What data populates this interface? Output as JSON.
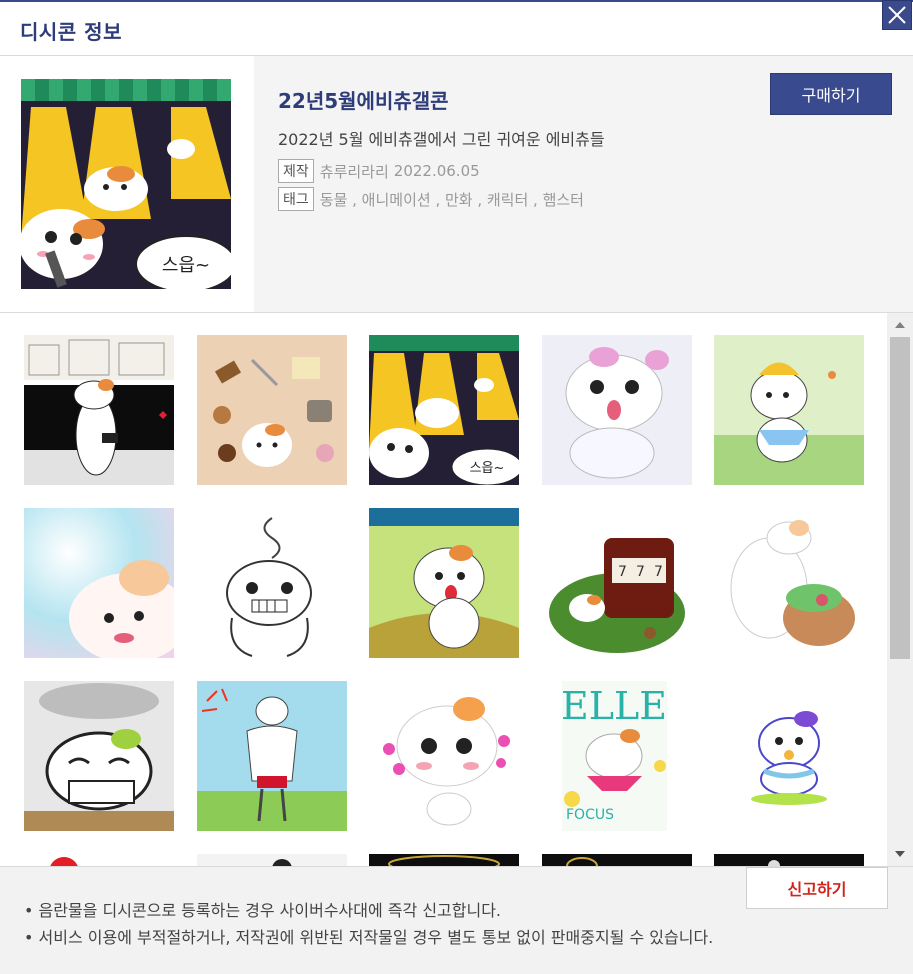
{
  "header": {
    "title": "디시콘 정보"
  },
  "dcon": {
    "title": "22년5월에비츄갤콘",
    "description": "2022년 5월 에비츄갤에서 그린 귀여운 에비츄들",
    "maker_label": "제작",
    "maker": "츄루리라리",
    "date": "2022.06.05",
    "tag_label": "태그",
    "tags": "동물 , 애니메이션 , 만화 , 캐릭터 , 햄스터",
    "buy_label": "구매하기",
    "thumb_caption": "스읍~"
  },
  "stickers": [
    {
      "name": "sticker-hamster-street-walk"
    },
    {
      "name": "sticker-hamster-cafe"
    },
    {
      "name": "sticker-hamster-singing"
    },
    {
      "name": "sticker-hamster-surprised"
    },
    {
      "name": "sticker-hamster-hat-dance"
    },
    {
      "name": "sticker-hamster-sky"
    },
    {
      "name": "sticker-hamster-sketch"
    },
    {
      "name": "sticker-hamster-wave"
    },
    {
      "name": "sticker-hamster-slot-machine"
    },
    {
      "name": "sticker-hamster-salad"
    },
    {
      "name": "sticker-hamster-cup-note"
    },
    {
      "name": "sticker-hamster-muscle"
    },
    {
      "name": "sticker-hamster-hearts"
    },
    {
      "name": "sticker-hamster-magazine"
    },
    {
      "name": "sticker-hamster-pacifier"
    }
  ],
  "sticker_text": {
    "singing_caption": "스읍~",
    "magazine_title": "ELLE",
    "magazine_sub": "FOCUS"
  },
  "footer": {
    "report_label": "신고하기",
    "notices": [
      "• 음란물을 디시콘으로 등록하는 경우 사이버수사대에 즉각 신고합니다.",
      "• 서비스 이용에 부적절하거나, 저작권에 위반된 저작물일 경우 별도 통보 없이 판매중지될 수 있습니다."
    ]
  },
  "colors": {
    "brand": "#3a4a8f",
    "report": "#d0241c"
  }
}
